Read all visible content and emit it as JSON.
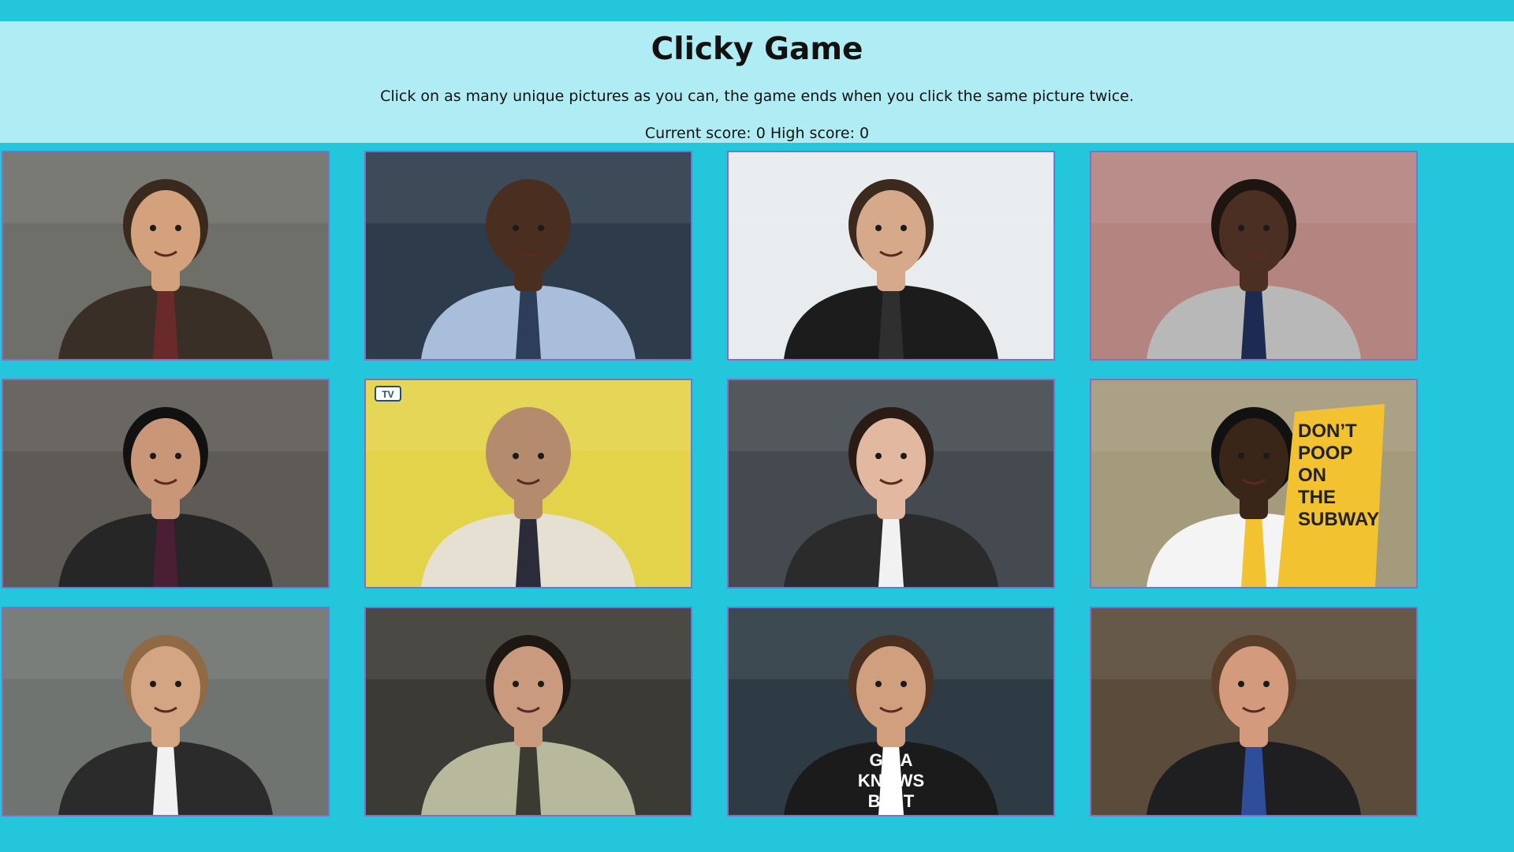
{
  "header": {
    "title": "Clicky Game",
    "instructions": "Click on as many unique pictures as you can, the game ends when you click the same picture twice.",
    "score_line": "Current score: 0 High score: 0"
  },
  "cards": [
    {
      "name": "card-cop-brown-jacket",
      "bg": "#6f6f6a",
      "skin": "#d3a27d",
      "hair": "#3a2a1e",
      "outfit": "#3a2f27",
      "accent": "#6b2a2a"
    },
    {
      "name": "card-bald-blue-shirt",
      "bg": "#2d3b4a",
      "skin": "#4a2e1f",
      "hair": "#4a2e1f",
      "outfit": "#a9bedb",
      "accent": "#2c3e5a"
    },
    {
      "name": "card-leather-jacket",
      "bg": "#e9ecef",
      "skin": "#d6a98a",
      "hair": "#3b2a1d",
      "outfit": "#1c1c1c",
      "accent": "#2f2f2f"
    },
    {
      "name": "card-grey-hoodie",
      "bg": "#b48580",
      "skin": "#4b2f22",
      "hair": "#1e1410",
      "outfit": "#b8b8b8",
      "accent": "#1d2b52"
    },
    {
      "name": "card-dark-curly-hair",
      "bg": "#5e5a55",
      "skin": "#c99778",
      "hair": "#111111",
      "outfit": "#262626",
      "accent": "#4a1e33"
    },
    {
      "name": "card-yellow-backdrop",
      "bg": "#e3d34a",
      "skin": "#b58b6e",
      "hair": "#b58b6e",
      "outfit": "#e6e0d3",
      "accent": "#2b2b3a",
      "text": "TV"
    },
    {
      "name": "card-dark-blazer",
      "bg": "#444a4f",
      "skin": "#e2b8a0",
      "hair": "#2a1b14",
      "outfit": "#2b2b2b",
      "accent": "#f1f1f1"
    },
    {
      "name": "card-dont-poop-sign",
      "bg": "#a49a7c",
      "skin": "#3a2519",
      "hair": "#111111",
      "outfit": "#f4f4f4",
      "accent": "#f2c230",
      "text": "DON’T POOP ON THE SUBWAY"
    },
    {
      "name": "card-glasses-vest",
      "bg": "#6f7470",
      "skin": "#d3a583",
      "hair": "#8f6a45",
      "outfit": "#2b2b2b",
      "accent": "#f1f1f1"
    },
    {
      "name": "card-surprised-face",
      "bg": "#3b3a34",
      "skin": "#c99a7d",
      "hair": "#1f1712",
      "outfit": "#b8b99c",
      "accent": "#3b3b32"
    },
    {
      "name": "card-gina-knows-best",
      "bg": "#2e3b44",
      "skin": "#d0a07e",
      "hair": "#4a2f20",
      "outfit": "#1b1b1b",
      "accent": "#ffffff",
      "text": "GINA KNOWS BEST"
    },
    {
      "name": "card-dark-suit",
      "bg": "#5a4b3b",
      "skin": "#d39a7e",
      "hair": "#5a3e2a",
      "outfit": "#1f1f22",
      "accent": "#2e4d9a"
    }
  ]
}
